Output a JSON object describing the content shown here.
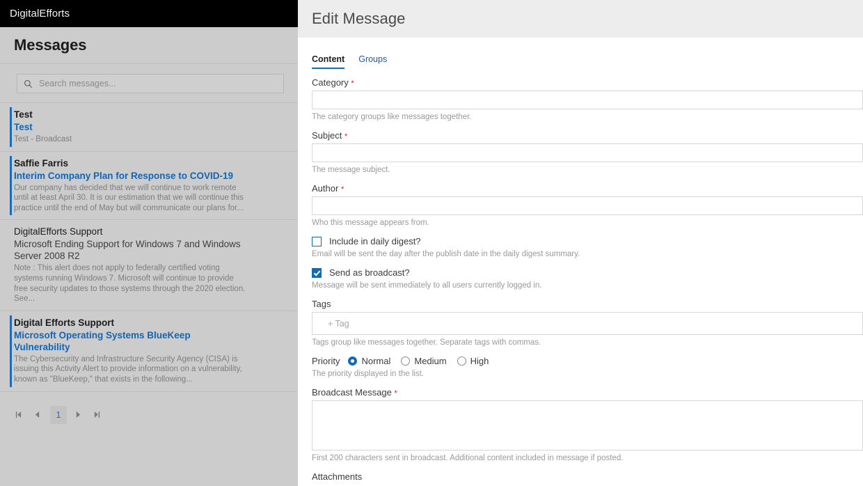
{
  "app": {
    "brand": "DigitalEfforts"
  },
  "sidebar": {
    "title": "Messages",
    "search": {
      "placeholder": "Search messages...",
      "value": "",
      "icon": "search-icon"
    },
    "messages": [
      {
        "author": "Test",
        "subject": "Test",
        "preview": "Test - Broadcast",
        "accent": true,
        "author_bold": true,
        "subject_link": true
      },
      {
        "author": "Saffie Farris",
        "subject": "Interim Company Plan for Response to COVID-19",
        "preview": "Our company has decided that we will continue to work remote until at least April 30. It is our estimation that we will continue this practice until the end of May but will communicate our plans for...",
        "accent": true,
        "author_bold": true,
        "subject_link": true
      },
      {
        "author": "DigitalEfforts Support",
        "subject": "Microsoft Ending Support for Windows 7 and Windows Server 2008 R2",
        "preview": "Note : This alert does not apply to federally certified voting systems running Windows 7. Microsoft will continue to provide free security updates to those systems through the 2020 election. See...",
        "accent": false,
        "author_bold": false,
        "subject_link": false
      },
      {
        "author": "Digital Efforts Support",
        "subject": "Microsoft Operating Systems BlueKeep Vulnerability",
        "preview": "The Cybersecurity and Infrastructure Security Agency (CISA) is issuing this Activity Alert to provide information on a vulnerability, known as \"BlueKeep,\" that exists in the following...",
        "accent": true,
        "author_bold": true,
        "subject_link": true
      }
    ],
    "pager": {
      "first_icon": "first-page-icon",
      "prev_icon": "previous-page-icon",
      "current_page": "1",
      "next_icon": "next-page-icon",
      "last_icon": "last-page-icon"
    }
  },
  "editor": {
    "title": "Edit Message",
    "tabs": [
      {
        "label": "Content",
        "active": true
      },
      {
        "label": "Groups",
        "active": false
      }
    ],
    "fields": {
      "category": {
        "label": "Category",
        "required_mark": "*",
        "value": "",
        "hint": "The category groups like messages together."
      },
      "subject": {
        "label": "Subject",
        "required_mark": "*",
        "value": "",
        "hint": "The message subject."
      },
      "author": {
        "label": "Author",
        "required_mark": "*",
        "value": "",
        "hint": "Who this message appears from."
      },
      "daily_digest": {
        "label": "Include in daily digest?",
        "checked": false,
        "hint": "Email will be sent the day after the publish date in the daily digest summary."
      },
      "broadcast": {
        "label": "Send as broadcast?",
        "checked": true,
        "hint": "Message will be sent immediately to all users currently logged in."
      },
      "tags": {
        "label": "Tags",
        "placeholder": "+ Tag",
        "value": "",
        "hint": "Tags group like messages together. Separate tags with commas."
      },
      "priority": {
        "label": "Priority",
        "options": [
          {
            "label": "Normal",
            "selected": true
          },
          {
            "label": "Medium",
            "selected": false
          },
          {
            "label": "High",
            "selected": false
          }
        ],
        "hint": "The priority displayed in the list."
      },
      "broadcast_message": {
        "label": "Broadcast Message",
        "required_mark": "*",
        "value": "",
        "hint": "First 200 characters sent in broadcast. Additional content included in message if posted."
      },
      "attachments": {
        "label": "Attachments"
      }
    }
  },
  "colors": {
    "accent": "#0f6cbd",
    "link": "#1464b4",
    "required": "#e81123",
    "brandbar": "#000000",
    "sidebar_bg": "#cccccc"
  }
}
